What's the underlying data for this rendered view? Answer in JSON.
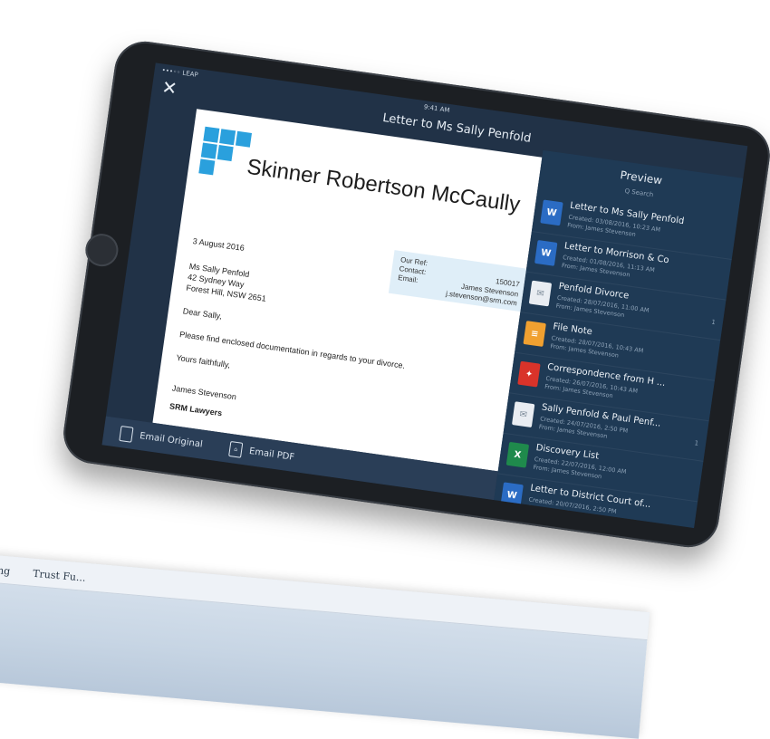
{
  "background": {
    "tabs": [
      "ounting",
      "Trust Fu..."
    ]
  },
  "status_bar": {
    "carrier": "•••◦◦ LEAP",
    "time": "9:41 AM"
  },
  "nav": {
    "title": "Letter to Ms Sally Penfold"
  },
  "document": {
    "firm_name": "Skinner Robertson McCaully",
    "ref": {
      "our_ref_label": "Our Ref:",
      "our_ref_value": "150017",
      "contact_label": "Contact:",
      "contact_value": "James Stevenson",
      "email_label": "Email:",
      "email_value": "j.stevenson@srm.com"
    },
    "date": "3 August 2016",
    "recipient_line1": "Ms Sally Penfold",
    "recipient_line2": "42 Sydney Way",
    "recipient_line3": "Forest Hill, NSW 2651",
    "salutation": "Dear Sally,",
    "body": "Please find enclosed documentation in regards to your divorce.",
    "closing": "Yours faithfully,",
    "signatory": "James Stevenson",
    "firm_short": "SRM Lawyers"
  },
  "actions": {
    "email_original": "Email Original",
    "email_pdf": "Email PDF"
  },
  "preview": {
    "title": "Preview",
    "search_placeholder": "Q Search",
    "items": [
      {
        "icon": "word-icon",
        "color": "#2b6cc4",
        "glyph": "W",
        "title": "Letter to Ms Sally Penfold",
        "created": "Created: 03/08/2016, 10:23 AM",
        "from": "From: James Stevenson",
        "count": ""
      },
      {
        "icon": "word-icon",
        "color": "#2b6cc4",
        "glyph": "W",
        "title": "Letter to Morrison & Co",
        "created": "Created: 01/08/2016, 11:13 AM",
        "from": "From: James Stevenson",
        "count": ""
      },
      {
        "icon": "email-icon",
        "color": "#e9edf2",
        "glyph": "✉",
        "title": "Penfold Divorce",
        "created": "Created: 28/07/2016, 11:00 AM",
        "from": "From: James Stevenson",
        "count": "1"
      },
      {
        "icon": "file-note-icon",
        "color": "#f0a030",
        "glyph": "≡",
        "title": "File Note",
        "created": "Created: 28/07/2016, 10:43 AM",
        "from": "From: James Stevenson",
        "count": ""
      },
      {
        "icon": "pdf-icon",
        "color": "#d9332a",
        "glyph": "✦",
        "title": "Correspondence from H ...",
        "created": "Created: 26/07/2016, 10:43 AM",
        "from": "From: James Stevenson",
        "count": ""
      },
      {
        "icon": "email-icon",
        "color": "#e9edf2",
        "glyph": "✉",
        "title": "Sally Penfold & Paul Penf...",
        "created": "Created: 24/07/2016, 2:50 PM",
        "from": "From: James Stevenson",
        "count": "1"
      },
      {
        "icon": "excel-icon",
        "color": "#1f8a4c",
        "glyph": "X",
        "title": "Discovery List",
        "created": "Created: 22/07/2016, 12:00 AM",
        "from": "From: James Stevenson",
        "count": ""
      },
      {
        "icon": "word-icon",
        "color": "#2b6cc4",
        "glyph": "W",
        "title": "Letter to District Court of...",
        "created": "Created: 20/07/2016, 2:50 PM",
        "from": "From: James Stevenson",
        "count": ""
      }
    ]
  }
}
